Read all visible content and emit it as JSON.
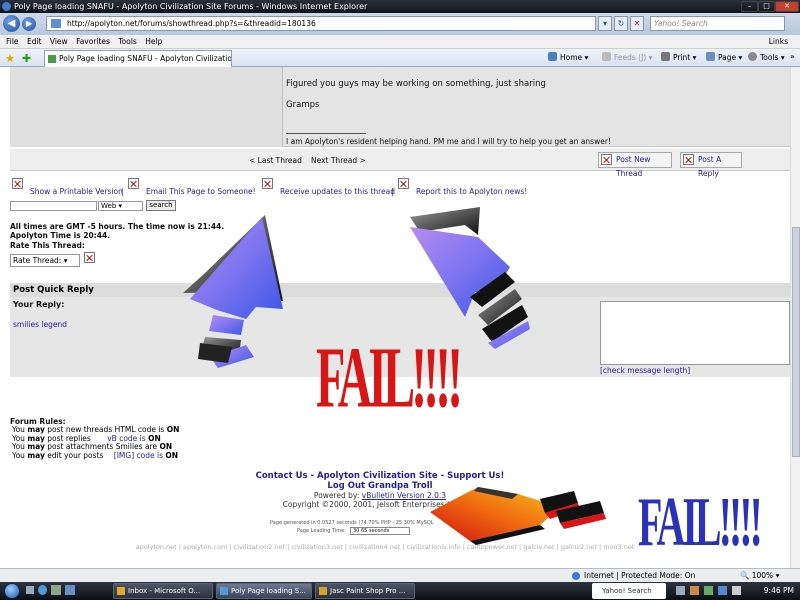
{
  "window": {
    "title": "Poly Page loading SNAFU - Apolyton Civilization Site Forums - Windows Internet Explorer"
  },
  "address": {
    "url": "http://apolyton.net/forums/showthread.php?s=&threadid=180136",
    "search_placeholder": "Yahoo! Search"
  },
  "menu": [
    "File",
    "Edit",
    "View",
    "Favorites",
    "Tools",
    "Help"
  ],
  "links_label": "Links",
  "tab": {
    "title": "Poly Page loading SNAFU - Apolyton Civilization ..."
  },
  "toolbar": {
    "home": "Home",
    "feeds": "Feeds (J)",
    "print": "Print",
    "page": "Page",
    "tools": "Tools"
  },
  "post": {
    "line1": "Figured you guys may be working on something, just sharing",
    "signoff": "Gramps",
    "signature": "I am Apolyton's resident helping hand. PM me and I will try to help you get an answer!"
  },
  "thread_nav": {
    "last": "< Last Thread",
    "next": "Next Thread >",
    "new_thread": "Post New Thread",
    "reply": "Post A Reply"
  },
  "thread_tools": {
    "printable": "Show a Printable Version",
    "email": "Email This Page to Someone!",
    "updates": "Receive updates to this thread",
    "report": "Report this to Apolyton news!",
    "sep": "|"
  },
  "search": {
    "scope": "Web",
    "button": "search"
  },
  "times": {
    "line1": "All times are GMT -5 hours. The time now is 21:44.",
    "line2": "Apolyton Time is 20:44."
  },
  "rate": {
    "label": "Rate This Thread:",
    "select": "Rate Thread:"
  },
  "quick_reply": {
    "title": "Post Quick Reply",
    "your_reply": "Your Reply:",
    "smilies": "smilies legend",
    "check_length": "[check message length]"
  },
  "forum_rules": {
    "title": "Forum Rules:",
    "lines": [
      [
        "You",
        "may",
        "post new threads",
        "HTML code is",
        "ON"
      ],
      [
        "You",
        "may",
        "post replies",
        "vB code is",
        "ON"
      ],
      [
        "You",
        "may",
        "post attachments",
        "Smilies are",
        "ON"
      ],
      [
        "You",
        "may",
        "edit your posts",
        "[IMG] code is",
        "ON"
      ]
    ]
  },
  "footer": {
    "links1": "Contact Us - Apolyton Civilization Site - Support Us!",
    "links2": "Log Out Grandpa Troll",
    "powered_prefix": "Powered by:",
    "powered_link": "vBulletin Version 2.0.3",
    "copyright": "Copyright ©2000, 2001, Jelsoft Enterprises Limited.",
    "generated": "Page generated in 0.0527 seconds (74.70% PHP - 25.30% MySQL",
    "loading_label": "Page Loading Time:",
    "loading_value": "30.65 seconds",
    "sites": "apolyton.net | apolyton.com | civilization2.net | civilization3.net | civilization4.net | civilizationiv.info | calltopower.net | galciv.net | galciv2.net | moo3.net"
  },
  "overlay": {
    "fail_text": "FAIL!!!!",
    "fail_color": "#d81616",
    "fail2_color": "#2a33b8"
  },
  "status": {
    "zone": "Internet | Protected Mode: On",
    "zoom": "100%"
  },
  "taskbar": {
    "tasks": [
      "Inbox - Microsoft O...",
      "Poly Page loading S...",
      "Jasc Paint Shop Pro ..."
    ],
    "yahoo": "Yahoo! Search",
    "clock": "9:46 PM"
  }
}
